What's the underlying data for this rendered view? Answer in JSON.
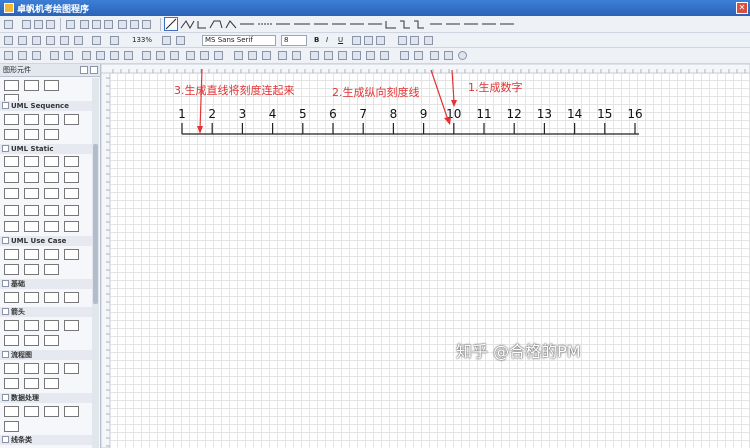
{
  "window": {
    "title": "卓帆机考绘图程序"
  },
  "toolbar": {
    "zoom": "133%",
    "font_name": "MS Sans Serif",
    "font_size": "8",
    "bold": "B",
    "italic": "I",
    "underline": "U"
  },
  "panel": {
    "title": "图形元件",
    "sections": [
      {
        "label": "UML Sequence"
      },
      {
        "label": "UML Static"
      },
      {
        "label": "UML Use Case"
      },
      {
        "label": "基础"
      },
      {
        "label": "箭头"
      },
      {
        "label": "流程图"
      },
      {
        "label": "数据处理"
      },
      {
        "label": "线条类"
      }
    ]
  },
  "ruler_scale": {
    "labels": [
      "1",
      "2",
      "3",
      "4",
      "5",
      "6",
      "7",
      "8",
      "9",
      "10",
      "11",
      "12",
      "13",
      "14",
      "15",
      "16"
    ]
  },
  "annotations": [
    {
      "text": "3.生成直线将刻度连起来"
    },
    {
      "text": "2.生成纵向刻度线"
    },
    {
      "text": "1.生成数字"
    }
  ],
  "watermark": "知乎 @合格的PM",
  "colors": {
    "annotation": "#e23434",
    "titlebar": "#2f6fc9"
  }
}
